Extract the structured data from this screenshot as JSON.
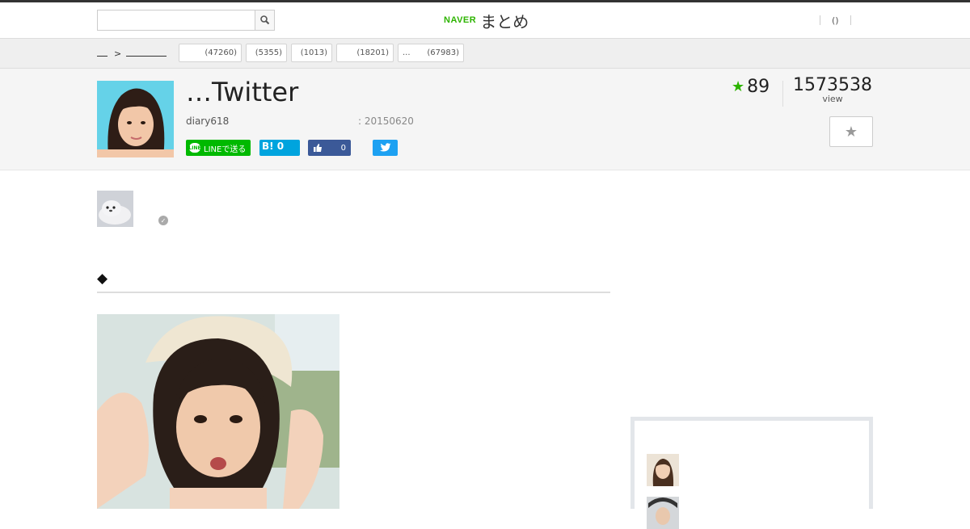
{
  "header": {
    "search": {
      "value": "",
      "placeholder": ""
    },
    "logo": {
      "brand": "NAVER",
      "product": "まとめ"
    },
    "mypage_label": "()"
  },
  "breadcrumb": {
    "arrow": ">"
  },
  "categories": [
    {
      "label": "",
      "count": "(47260)"
    },
    {
      "label": "",
      "count": "(5355)"
    },
    {
      "label": "",
      "count": "(1013)"
    },
    {
      "label": "",
      "count": "(18201)"
    },
    {
      "label": "...",
      "count": "(67983)"
    }
  ],
  "article": {
    "title": "…Twitter",
    "author": "diary618",
    "date": ": 20150620",
    "favorites": "89",
    "views": "1573538",
    "views_label": "view"
  },
  "share": {
    "line_label": "LINEで送る",
    "line_icon": "LINE",
    "hatena_label": "B! 0",
    "fb_count": "0"
  },
  "content": {
    "section_heading": "◆"
  },
  "colors": {
    "brand_green": "#2db400",
    "line_green": "#00b900",
    "hatena_blue": "#00a4de",
    "facebook_blue": "#3b5998",
    "twitter_blue": "#1da1f2"
  }
}
